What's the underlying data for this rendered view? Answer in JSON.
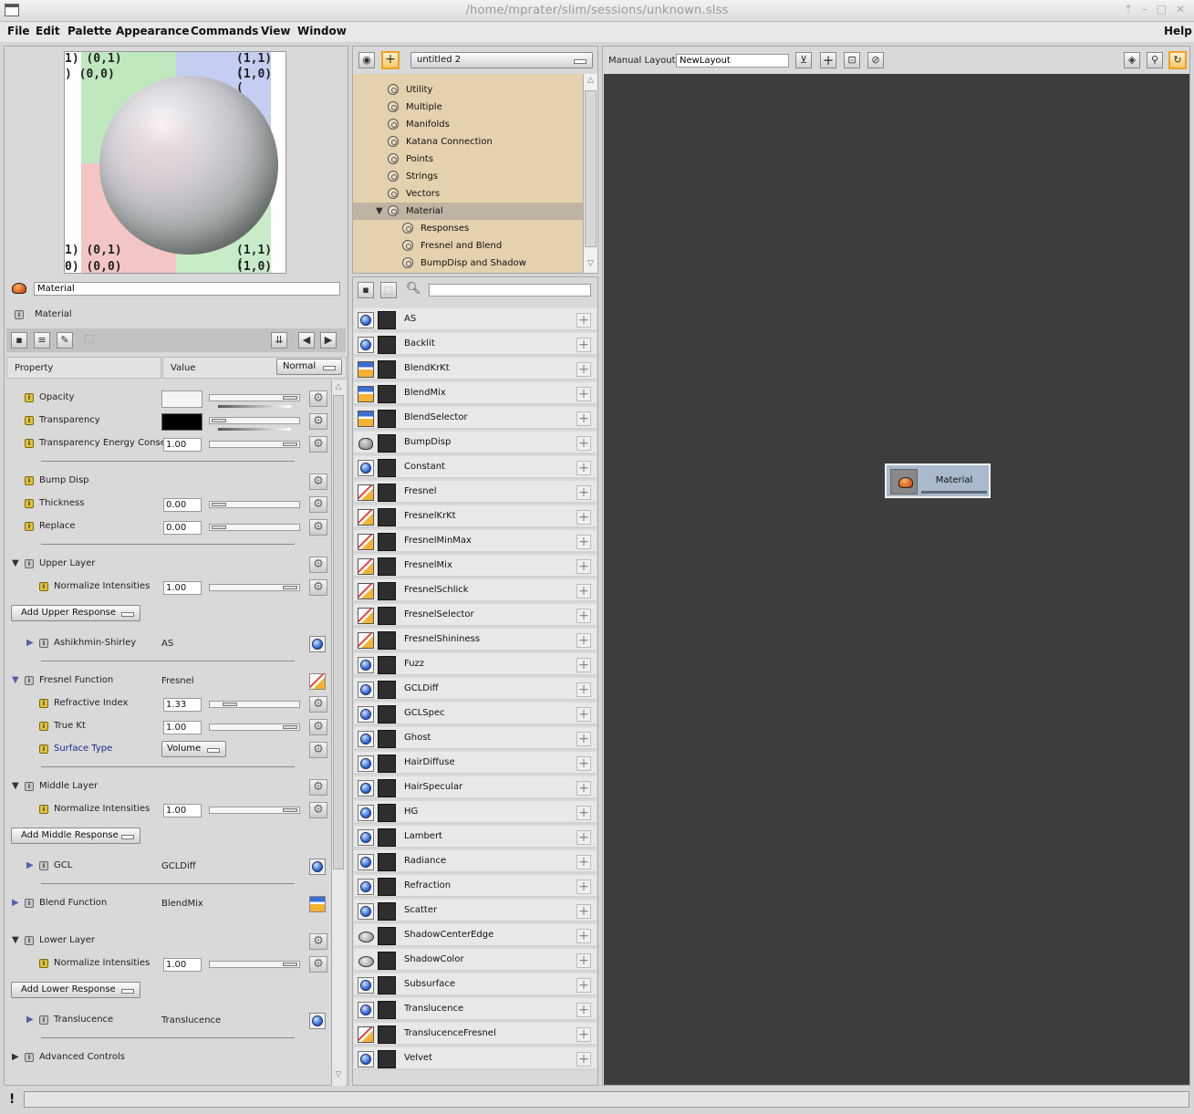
{
  "window": {
    "title": "/home/mprater/slim/sessions/unknown.slss",
    "controls": [
      "⇡",
      "–",
      "□",
      "✕"
    ]
  },
  "menubar": {
    "items": [
      "File",
      "Edit",
      "Palette",
      "Appearance",
      "Commands",
      "View",
      "Window"
    ],
    "help": "Help"
  },
  "preview": {
    "labels": {
      "tl_top": "1) (0,1)",
      "tl_bot": ") (0,0)",
      "tr_top": "(1,1) (",
      "tr_bot": "(1,0) (",
      "bl_top": "1) (0,1)",
      "bl_bot": "0) (0,0)",
      "br_top": "(1,1) (",
      "br_bot": "(1,0) ("
    }
  },
  "appearance": {
    "name_value": "Material",
    "type_label": "Material"
  },
  "property_header": {
    "property": "Property",
    "value": "Value",
    "mode": "Normal"
  },
  "properties": {
    "opacity": "Opacity",
    "transparency": "Transparency",
    "transparency_energy": "Transparency Energy Conse",
    "transparency_energy_value": "1.00",
    "bump_disp": "Bump Disp",
    "thickness": "Thickness",
    "thickness_value": "0.00",
    "replace": "Replace",
    "replace_value": "0.00",
    "upper_layer": "Upper Layer",
    "upper_normalize": "Normalize Intensities",
    "upper_normalize_value": "1.00",
    "add_upper": "Add Upper Response",
    "ashikhmin": "Ashikhmin-Shirley",
    "ashikhmin_value": "AS",
    "fresnel_function": "Fresnel Function",
    "fresnel_function_value": "Fresnel",
    "refractive_index": "Refractive Index",
    "refractive_index_value": "1.33",
    "true_kt": "True Kt",
    "true_kt_value": "1.00",
    "surface_type": "Surface Type",
    "surface_type_value": "Volume",
    "middle_layer": "Middle Layer",
    "middle_normalize": "Normalize Intensities",
    "middle_normalize_value": "1.00",
    "add_middle": "Add Middle Response",
    "gcl": "GCL",
    "gcl_value": "GCLDiff",
    "blend_function": "Blend Function",
    "blend_function_value": "BlendMix",
    "lower_layer": "Lower Layer",
    "lower_normalize": "Normalize Intensities",
    "lower_normalize_value": "1.00",
    "add_lower": "Add Lower Response",
    "translucence": "Translucence",
    "translucence_value": "Translucence",
    "advanced": "Advanced Controls"
  },
  "palette": {
    "name": "untitled 2",
    "tree": [
      {
        "label": "Utility"
      },
      {
        "label": "Multiple"
      },
      {
        "label": "Manifolds"
      },
      {
        "label": "Katana Connection"
      },
      {
        "label": "Points"
      },
      {
        "label": "Strings"
      },
      {
        "label": "Vectors"
      },
      {
        "label": "Material"
      },
      {
        "label": "Responses"
      },
      {
        "label": "Fresnel and Blend"
      },
      {
        "label": "BumpDisp and Shadow"
      }
    ],
    "search_placeholder": ""
  },
  "shaders": [
    {
      "name": "AS",
      "icon": "ball-icon"
    },
    {
      "name": "Backlit",
      "icon": "ball-icon"
    },
    {
      "name": "BlendKrKt",
      "icon": "blend-icon"
    },
    {
      "name": "BlendMix",
      "icon": "blend-icon"
    },
    {
      "name": "BlendSelector",
      "icon": "blend-icon"
    },
    {
      "name": "BumpDisp",
      "icon": "bump-icon"
    },
    {
      "name": "Constant",
      "icon": "ball-icon"
    },
    {
      "name": "Fresnel",
      "icon": "fresnel-icon"
    },
    {
      "name": "FresnelKrKt",
      "icon": "fresnel-icon"
    },
    {
      "name": "FresnelMinMax",
      "icon": "fresnel-icon"
    },
    {
      "name": "FresnelMix",
      "icon": "fresnel-icon"
    },
    {
      "name": "FresnelSchlick",
      "icon": "fresnel-icon"
    },
    {
      "name": "FresnelSelector",
      "icon": "fresnel-icon"
    },
    {
      "name": "FresnelShininess",
      "icon": "fresnel-icon"
    },
    {
      "name": "Fuzz",
      "icon": "ball-icon"
    },
    {
      "name": "GCLDiff",
      "icon": "ball-icon"
    },
    {
      "name": "GCLSpec",
      "icon": "ball-icon"
    },
    {
      "name": "Ghost",
      "icon": "ball-icon"
    },
    {
      "name": "HairDiffuse",
      "icon": "ball-icon"
    },
    {
      "name": "HairSpecular",
      "icon": "ball-icon"
    },
    {
      "name": "HG",
      "icon": "ball-icon"
    },
    {
      "name": "Lambert",
      "icon": "ball-icon"
    },
    {
      "name": "Radiance",
      "icon": "ball-icon"
    },
    {
      "name": "Refraction",
      "icon": "ball-icon"
    },
    {
      "name": "Scatter",
      "icon": "ball-icon"
    },
    {
      "name": "ShadowCenterEdge",
      "icon": "shadow-icon"
    },
    {
      "name": "ShadowColor",
      "icon": "shadow-icon"
    },
    {
      "name": "Subsurface",
      "icon": "ball-icon"
    },
    {
      "name": "Translucence",
      "icon": "ball-icon"
    },
    {
      "name": "TranslucenceFresnel",
      "icon": "fresnel-icon"
    },
    {
      "name": "Velvet",
      "icon": "ball-icon"
    }
  ],
  "layout": {
    "mode_label": "Manual Layout",
    "layout_name": "NewLayout",
    "node_label": "Material"
  },
  "status": {
    "icon": "!",
    "message": ""
  },
  "colors": {
    "tree_bg": "#e4d1ae",
    "canvas_bg": "#3d3d3d",
    "node_bg": "#a8bacb",
    "accent_orange": "#f0a020"
  }
}
